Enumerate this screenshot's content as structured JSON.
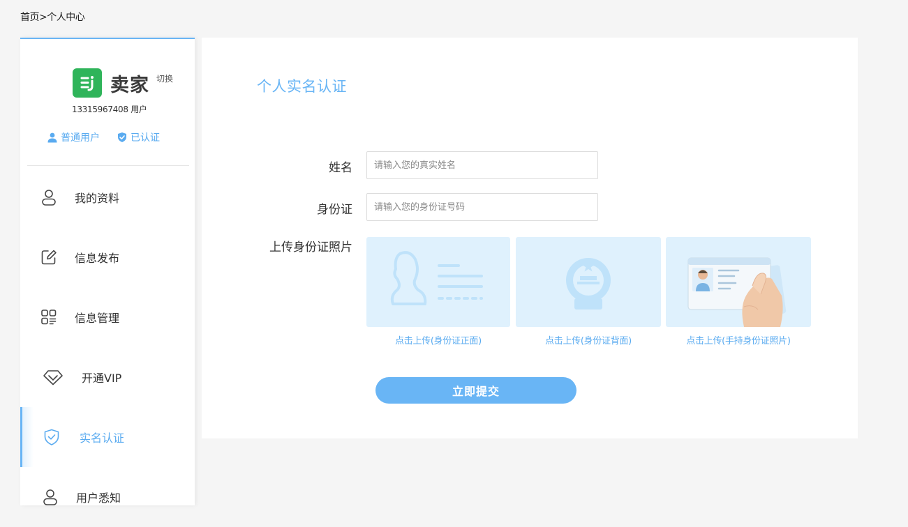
{
  "breadcrumb": "首页>个人中心",
  "sidebar": {
    "brand_name": "卖家",
    "switch_label": "切换",
    "phone_text": "13315967408 用户",
    "badge_user": "普通用户",
    "badge_verified": "已认证",
    "items": [
      {
        "label": "我的资料",
        "icon": "user-icon"
      },
      {
        "label": "信息发布",
        "icon": "edit-icon"
      },
      {
        "label": "信息管理",
        "icon": "grid-icon"
      },
      {
        "label": "开通VIP",
        "icon": "diamond-icon"
      },
      {
        "label": "实名认证",
        "icon": "shield-check-icon",
        "active": true
      },
      {
        "label": "用户悉知",
        "icon": "user-icon"
      }
    ]
  },
  "main": {
    "title": "个人实名认证",
    "name_label": "姓名",
    "name_placeholder": "请输入您的真实姓名",
    "id_label": "身份证",
    "id_placeholder": "请输入您的身份证号码",
    "upload_label": "上传身份证照片",
    "upload_front": "点击上传(身份证正面)",
    "upload_back": "点击上传(身份证背面)",
    "upload_hand": "点击上传(手持身份证照片)",
    "submit_label": "立即提交"
  },
  "colors": {
    "accent": "#69b5f5",
    "brand_green": "#2fb45a",
    "card_bg": "#dff1fd"
  }
}
